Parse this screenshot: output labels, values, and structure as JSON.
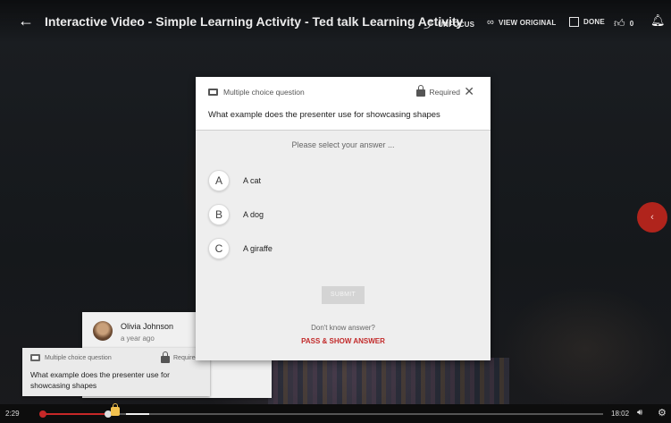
{
  "header": {
    "back_icon": "arrow-left-icon",
    "title": "Interactive Video - Simple Learning Activity - Ted talk Learning Activity",
    "unfocus_label": "UNFOCUS",
    "view_original_label": "VIEW ORIGINAL",
    "done_label": "DONE",
    "like_count": "0",
    "icons": [
      "unfocus-icon",
      "link-icon",
      "checkbox-icon",
      "thumbs-up-icon",
      "bell-icon"
    ]
  },
  "modal": {
    "type_label": "Multiple choice question",
    "required_label": "Required",
    "question": "What example does the presenter use for showcasing shapes",
    "prompt": "Please select your answer ...",
    "options": [
      {
        "letter": "A",
        "text": "A cat"
      },
      {
        "letter": "B",
        "text": "A dog"
      },
      {
        "letter": "C",
        "text": "A giraffe"
      }
    ],
    "submit_label": "SUBMIT",
    "dont_know": "Don't know answer?",
    "pass_label": "PASS & SHOW ANSWER"
  },
  "comment": {
    "name": "Olivia Johnson",
    "time": "a year ago"
  },
  "question_card": {
    "type_label": "Multiple choice question",
    "required_label": "Required",
    "text": "What example does the presenter use for showcasing shapes"
  },
  "player": {
    "current_time": "2:29",
    "duration": "18:02",
    "progress_fraction": 0.12,
    "accent_color": "#c62828",
    "marker_color": "#f2c14e"
  },
  "side_button": {
    "icon": "chevron-left-icon",
    "color": "#b0241c"
  }
}
